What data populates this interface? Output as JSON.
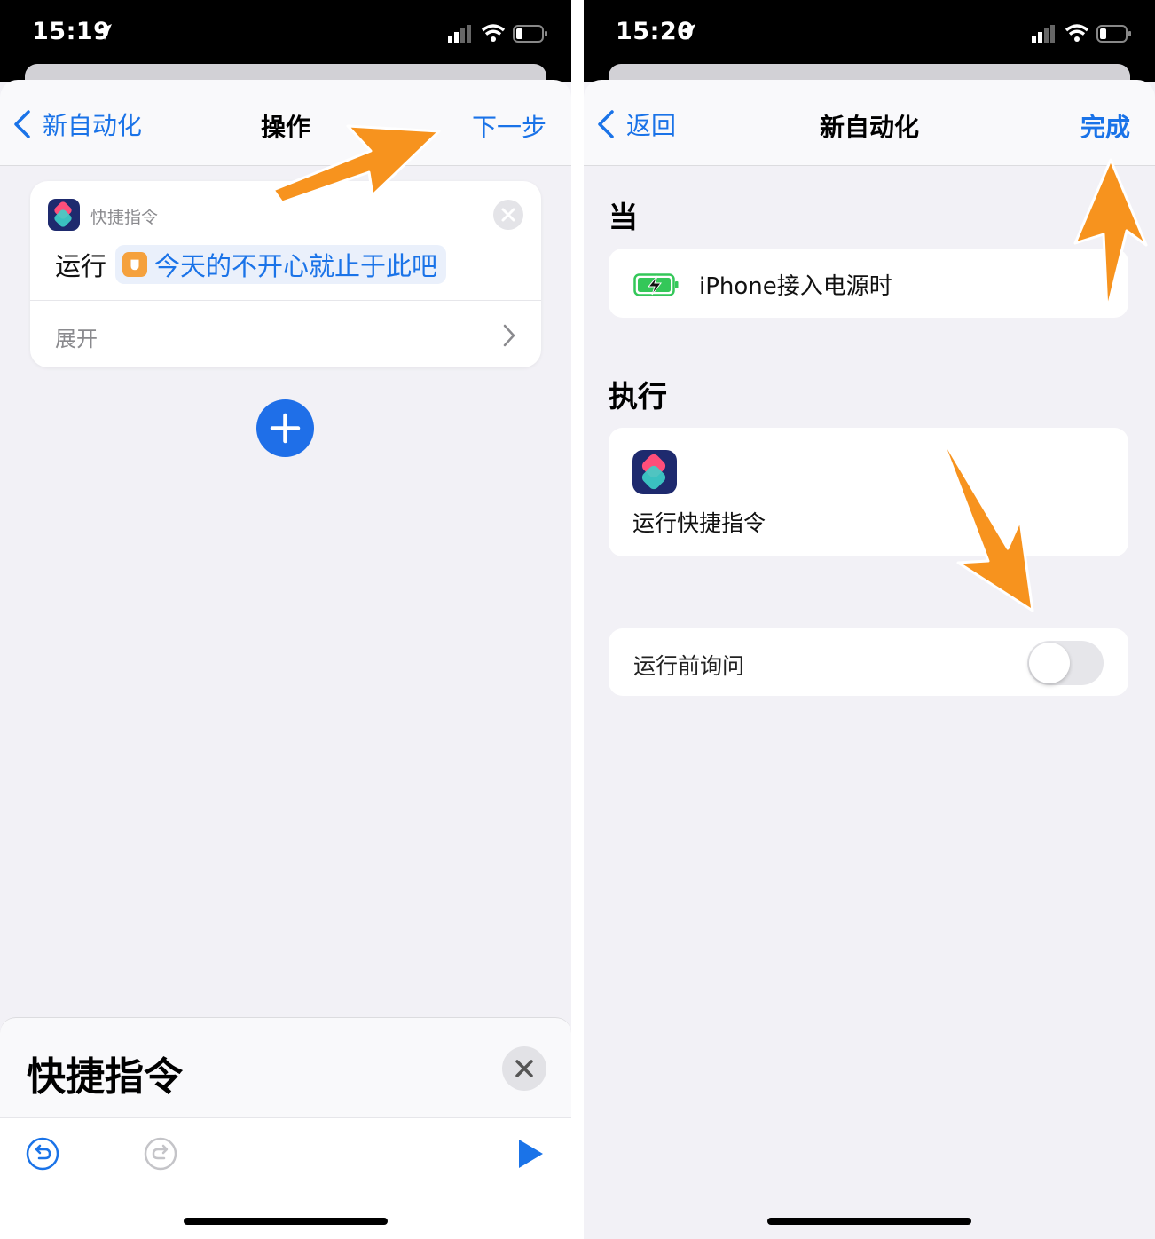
{
  "left_screen": {
    "status_time": "15:19",
    "nav": {
      "back_label": "新自动化",
      "title": "操作",
      "next_label": "下一步"
    },
    "action_card": {
      "app_name": "快捷指令",
      "run_label": "运行",
      "shortcut_name": "今天的不开心就止于此吧",
      "expand_label": "展开"
    },
    "bottom_sheet": {
      "title": "快捷指令"
    }
  },
  "right_screen": {
    "status_time": "15:20",
    "nav": {
      "back_label": "返回",
      "title": "新自动化",
      "done_label": "完成"
    },
    "when_title": "当",
    "trigger_text": "iPhone接入电源时",
    "do_title": "执行",
    "action_text": "运行快捷指令",
    "ask_before_running": {
      "label": "运行前询问",
      "enabled": false
    }
  },
  "colors": {
    "accent_blue": "#1a73e8",
    "add_button_blue": "#1f6fe8",
    "annotation_arrow": "#f7931e",
    "background": "#f2f1f6",
    "battery_green": "#34c759"
  }
}
